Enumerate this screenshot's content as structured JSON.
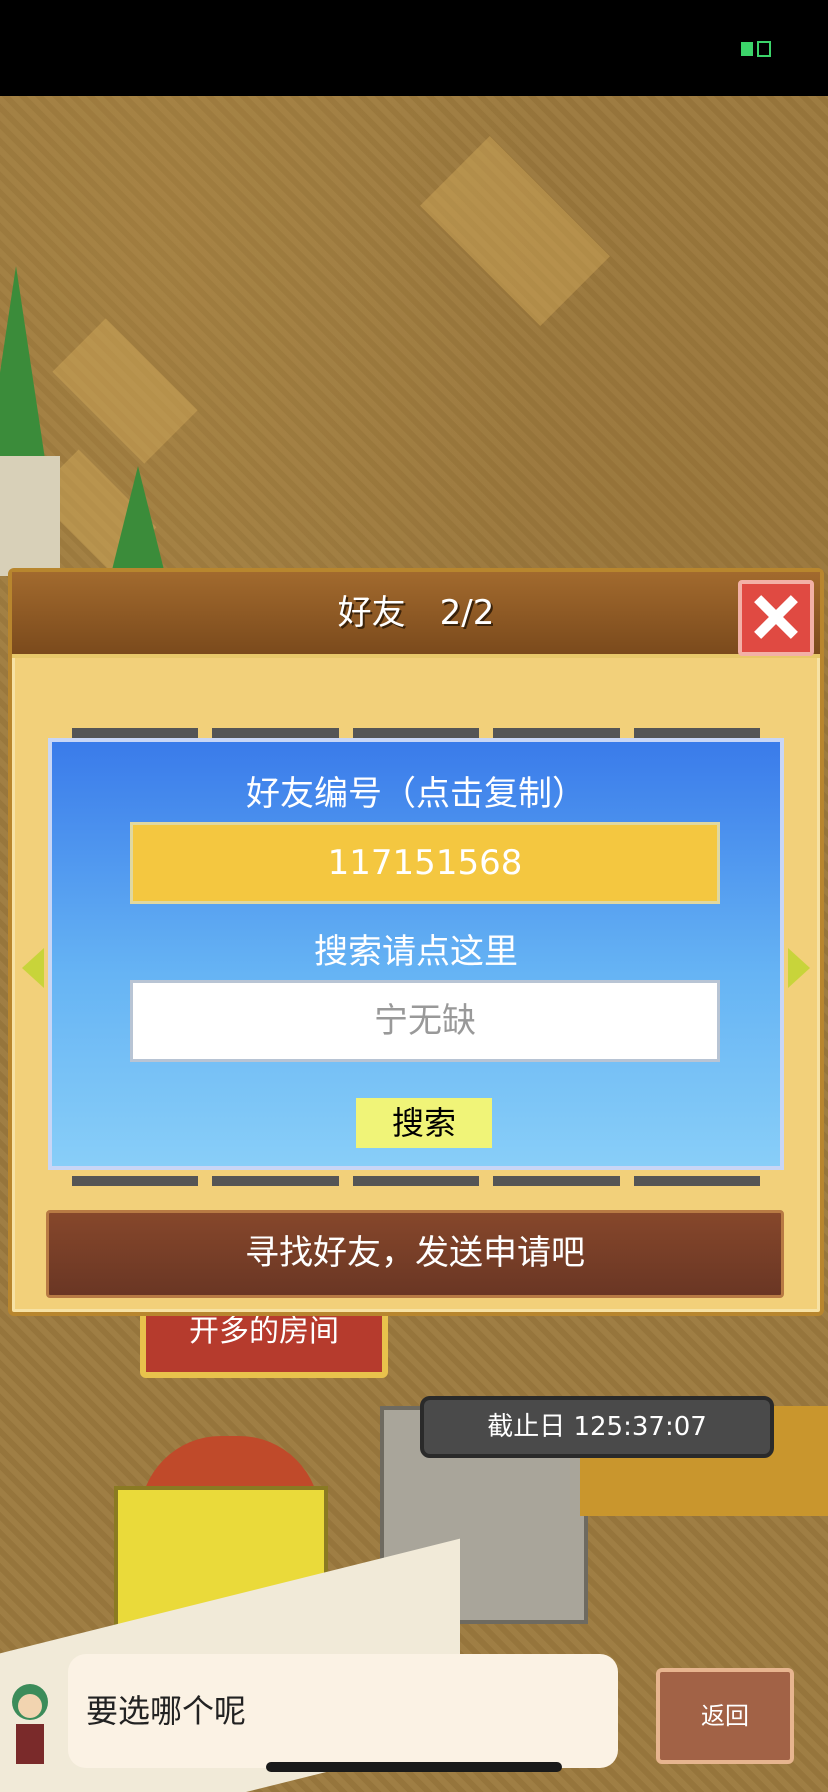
{
  "dialog": {
    "title": "好友　2/2",
    "friend_id_label": "好友编号（点击复制）",
    "friend_id": "117151568",
    "search_label": "搜索请点这里",
    "search_placeholder": "宁无缺",
    "search_button": "搜索",
    "send_request_button": "寻找好友，发送申请吧"
  },
  "scene": {
    "room_sign": "开多的房间",
    "deadline": "截止日 125:37:07"
  },
  "bottom": {
    "prompt": "要选哪个呢",
    "back_button": "返回"
  },
  "colors": {
    "accent_yellow": "#f4c740",
    "panel_blue": "#3a7bea",
    "close_red": "#e04a42",
    "header_brown": "#7b4a1c"
  }
}
